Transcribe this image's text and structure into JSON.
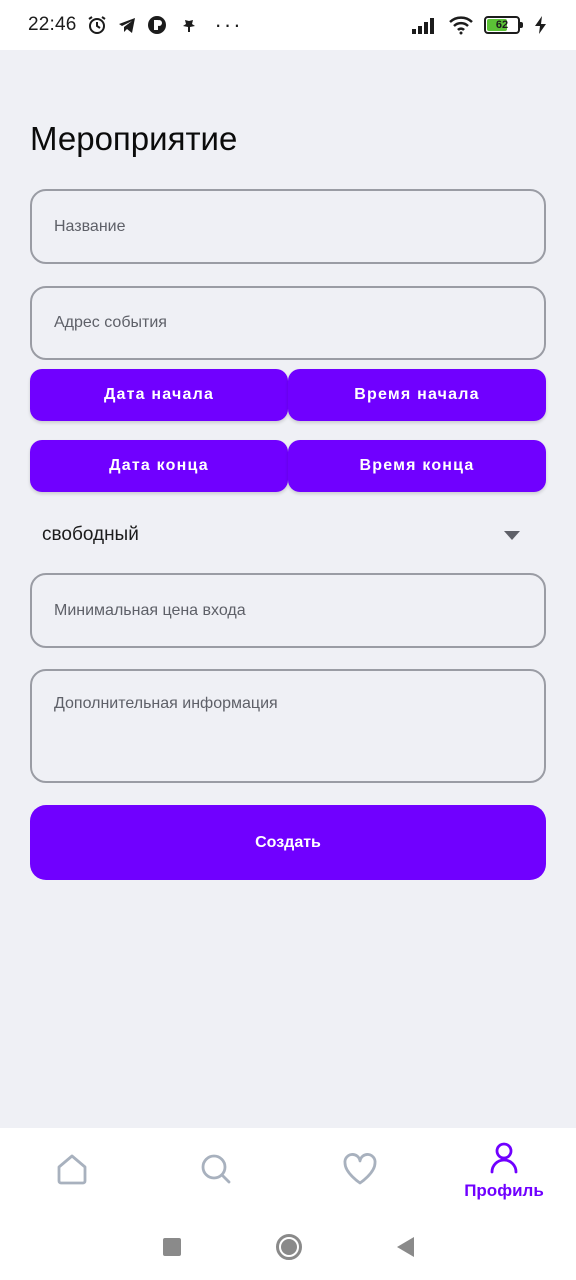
{
  "status_bar": {
    "time": "22:46",
    "battery_level": "62",
    "icons": [
      "alarm-icon",
      "telegram-icon",
      "app-icon",
      "maple-leaf-icon",
      "more-dots-icon",
      "signal-icon",
      "wifi-icon",
      "battery-icon",
      "charging-icon"
    ]
  },
  "page": {
    "title": "Мероприятие"
  },
  "form": {
    "name_placeholder": "Название",
    "address_placeholder": "Адрес события",
    "start_date_label": "Дата начала",
    "start_time_label": "Время начала",
    "end_date_label": "Дата конца",
    "end_time_label": "Время конца",
    "type_selected": "свободный",
    "min_price_placeholder": "Минимальная цена входа",
    "extra_info_placeholder": "Дополнительная информация",
    "create_label": "Создать"
  },
  "bottom_nav": {
    "items": [
      {
        "icon": "home-icon",
        "label": ""
      },
      {
        "icon": "search-icon",
        "label": ""
      },
      {
        "icon": "heart-icon",
        "label": ""
      },
      {
        "icon": "profile-icon",
        "label": "Профиль"
      }
    ]
  },
  "colors": {
    "accent": "#7000FF",
    "background": "#EFF0F5",
    "inactive_icon": "#A8B1BE"
  }
}
